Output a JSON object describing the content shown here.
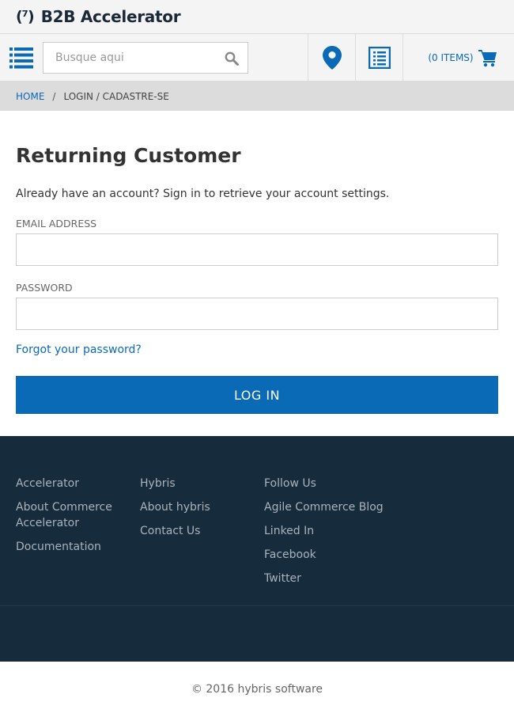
{
  "brand": {
    "logo_mark": "(⁷)",
    "name": "B2B Accelerator"
  },
  "search": {
    "placeholder": "Busque aqui"
  },
  "cart": {
    "count_label": "(0 ITEMS)"
  },
  "breadcrumb": {
    "home": "HOME",
    "separator": "/",
    "current": "LOGIN / CADASTRE-SE"
  },
  "login": {
    "title": "Returning Customer",
    "intro": "Already have an account? Sign in to retrieve your account settings.",
    "email_label": "EMAIL ADDRESS",
    "email_value": "",
    "password_label": "PASSWORD",
    "password_value": "",
    "forgot_label": "Forgot your password?",
    "submit_label": "LOG IN"
  },
  "footer": {
    "columns": [
      {
        "heading": "Accelerator",
        "links": [
          "About Commerce Accelerator",
          "Documentation"
        ]
      },
      {
        "heading": "Hybris",
        "links": [
          "About hybris",
          "Contact Us"
        ]
      },
      {
        "heading": "Follow Us",
        "links": [
          "Agile Commerce Blog",
          "Linked In",
          "Facebook",
          "Twitter"
        ]
      }
    ],
    "copyright": "© 2016 hybris software"
  },
  "icons": {
    "menu": "hamburger-icon",
    "search": "search-icon",
    "store_finder": "map-pin-icon",
    "quick_order": "list-icon",
    "cart": "cart-icon"
  },
  "colors": {
    "accent": "#0a6ab5",
    "footer_bg": "#162b3c",
    "topbar_bg": "#f4f4f4",
    "breadcrumb_bg": "#dcdcdc"
  }
}
